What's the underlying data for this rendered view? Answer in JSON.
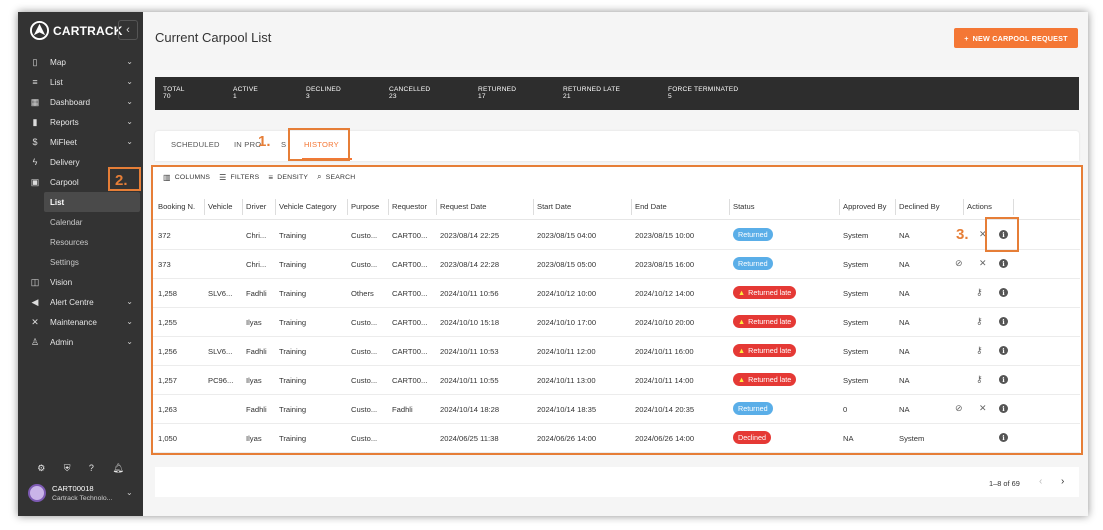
{
  "app": {
    "logo_text": "CARTRACK",
    "collapse_icon": "chevron-left-icon"
  },
  "sidebar": {
    "items": [
      {
        "label": "Map",
        "icon": "map-icon",
        "expandable": true
      },
      {
        "label": "List",
        "icon": "list-icon",
        "expandable": true
      },
      {
        "label": "Dashboard",
        "icon": "dashboard-icon",
        "expandable": true
      },
      {
        "label": "Reports",
        "icon": "bar-chart-icon",
        "expandable": true
      },
      {
        "label": "MiFleet",
        "icon": "dollar-icon",
        "expandable": true
      },
      {
        "label": "Delivery",
        "icon": "bolt-icon",
        "expandable": false
      },
      {
        "label": "Carpool",
        "icon": "calendar-icon",
        "expandable": false
      }
    ],
    "carpool_sub": [
      {
        "label": "List",
        "active": true
      },
      {
        "label": "Calendar",
        "active": false
      },
      {
        "label": "Resources",
        "active": false
      },
      {
        "label": "Settings",
        "active": false
      }
    ],
    "items_after": [
      {
        "label": "Vision",
        "icon": "vision-icon",
        "expandable": false
      },
      {
        "label": "Alert Centre",
        "icon": "megaphone-icon",
        "expandable": true
      },
      {
        "label": "Maintenance",
        "icon": "tools-icon",
        "expandable": true
      },
      {
        "label": "Admin",
        "icon": "users-icon",
        "expandable": true
      }
    ],
    "bottom_icons": [
      "settings-icon",
      "shield-icon",
      "help-icon",
      "bell-icon"
    ],
    "user": {
      "name": "CART00018",
      "company": "Cartrack Technolo..."
    }
  },
  "header": {
    "title": "Current Carpool List",
    "new_button": "NEW CARPOOL REQUEST"
  },
  "stats": [
    {
      "label": "TOTAL",
      "value": "70"
    },
    {
      "label": "ACTIVE",
      "value": "1"
    },
    {
      "label": "DECLINED",
      "value": "3"
    },
    {
      "label": "CANCELLED",
      "value": "23"
    },
    {
      "label": "RETURNED",
      "value": "17"
    },
    {
      "label": "RETURNED LATE",
      "value": "21"
    },
    {
      "label": "FORCE TERMINATED",
      "value": "5"
    }
  ],
  "tabs": [
    {
      "label": "SCHEDULED"
    },
    {
      "label": "IN PRO"
    },
    {
      "label": "S"
    },
    {
      "label": "HISTORY",
      "active": true
    }
  ],
  "toolbar": {
    "columns": "COLUMNS",
    "filters": "FILTERS",
    "density": "DENSITY",
    "search": "SEARCH"
  },
  "columns": [
    "Booking N.",
    "Vehicle",
    "Driver",
    "Vehicle Category",
    "Purpose",
    "Requestor",
    "Request Date",
    "Start Date",
    "End Date",
    "Status",
    "Approved By",
    "Declined By",
    "Actions"
  ],
  "rows": [
    {
      "booking": "372",
      "vehicle": "",
      "driver": "Chri...",
      "category": "Training",
      "purpose": "Custo...",
      "requestor": "CART00...",
      "request_date": "2023/08/14 22:25",
      "start": "2023/08/15 04:00",
      "end": "2023/08/15 10:00",
      "status": "Returned",
      "status_type": "returned",
      "approved": "System",
      "declined": "NA",
      "actions": "x-info"
    },
    {
      "booking": "373",
      "vehicle": "",
      "driver": "Chri...",
      "category": "Training",
      "purpose": "Custo...",
      "requestor": "CART00...",
      "request_date": "2023/08/14 22:28",
      "start": "2023/08/15 05:00",
      "end": "2023/08/15 16:00",
      "status": "Returned",
      "status_type": "returned",
      "approved": "System",
      "declined": "NA",
      "actions": "check-x-info"
    },
    {
      "booking": "1,258",
      "vehicle": "SLV6...",
      "driver": "Fadhli",
      "category": "Training",
      "purpose": "Others",
      "requestor": "CART00...",
      "request_date": "2024/10/11 10:56",
      "start": "2024/10/12 10:00",
      "end": "2024/10/12 14:00",
      "status": "Returned late",
      "status_type": "late",
      "approved": "System",
      "declined": "NA",
      "actions": "key-info"
    },
    {
      "booking": "1,255",
      "vehicle": "",
      "driver": "Ilyas",
      "category": "Training",
      "purpose": "Custo...",
      "requestor": "CART00...",
      "request_date": "2024/10/10 15:18",
      "start": "2024/10/10 17:00",
      "end": "2024/10/10 20:00",
      "status": "Returned late",
      "status_type": "late",
      "approved": "System",
      "declined": "NA",
      "actions": "key-info"
    },
    {
      "booking": "1,256",
      "vehicle": "SLV6...",
      "driver": "Fadhli",
      "category": "Training",
      "purpose": "Custo...",
      "requestor": "CART00...",
      "request_date": "2024/10/11 10:53",
      "start": "2024/10/11 12:00",
      "end": "2024/10/11 16:00",
      "status": "Returned late",
      "status_type": "late",
      "approved": "System",
      "declined": "NA",
      "actions": "key-info"
    },
    {
      "booking": "1,257",
      "vehicle": "PC96...",
      "driver": "Ilyas",
      "category": "Training",
      "purpose": "Custo...",
      "requestor": "CART00...",
      "request_date": "2024/10/11 10:55",
      "start": "2024/10/11 13:00",
      "end": "2024/10/11 14:00",
      "status": "Returned late",
      "status_type": "late",
      "approved": "System",
      "declined": "NA",
      "actions": "key-info"
    },
    {
      "booking": "1,263",
      "vehicle": "",
      "driver": "Fadhli",
      "category": "Training",
      "purpose": "Custo...",
      "requestor": "Fadhli",
      "request_date": "2024/10/14 18:28",
      "start": "2024/10/14 18:35",
      "end": "2024/10/14 20:35",
      "status": "Returned",
      "status_type": "returned",
      "approved": "0",
      "declined": "NA",
      "actions": "check-x-info"
    },
    {
      "booking": "1,050",
      "vehicle": "",
      "driver": "Ilyas",
      "category": "Training",
      "purpose": "Custo...",
      "requestor": "",
      "request_date": "2024/06/25 11:38",
      "start": "2024/06/26 14:00",
      "end": "2024/06/26 14:00",
      "status": "Declined",
      "status_type": "declined",
      "approved": "NA",
      "declined": "System",
      "actions": "info"
    }
  ],
  "pagination": {
    "text": "1–8 of 69"
  },
  "annotations": [
    {
      "label": "1."
    },
    {
      "label": "2."
    },
    {
      "label": "3."
    }
  ],
  "colors": {
    "accent": "#f47735",
    "sidebar": "#333333",
    "returned": "#5aaee8",
    "late": "#e53935"
  }
}
